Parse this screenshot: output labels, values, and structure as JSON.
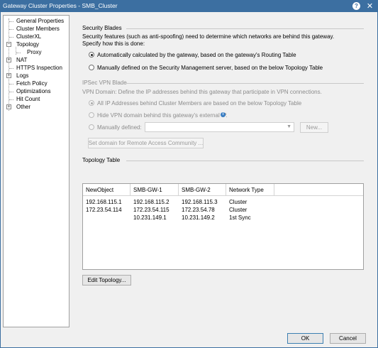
{
  "window": {
    "title": "Gateway Cluster Properties - SMB_Cluster",
    "help_icon": "?",
    "close_icon": "✕"
  },
  "tree": {
    "items": [
      {
        "label": "General Properties"
      },
      {
        "label": "Cluster Members"
      },
      {
        "label": "ClusterXL"
      },
      {
        "label": "Topology",
        "expanded": true,
        "selected": true
      },
      {
        "label": "Proxy"
      },
      {
        "label": "NAT",
        "expandable": true
      },
      {
        "label": "HTTPS Inspection"
      },
      {
        "label": "Logs",
        "expandable": true
      },
      {
        "label": "Fetch Policy"
      },
      {
        "label": "Optimizations"
      },
      {
        "label": "Hit Count"
      },
      {
        "label": "Other",
        "expandable": true
      }
    ]
  },
  "security_blades": {
    "title": "Security Blades",
    "description_1": "Security features (such as anti-spoofing) need to determine which networks are behind this gateway.",
    "description_2": "Specify how this is done:",
    "option_auto": "Automatically calculated by the gateway, based on the gateway's Routing Table",
    "option_manual": "Manually defined on the Security Management server, based on the below Topology Table",
    "selected": "auto"
  },
  "ipsec": {
    "title": "IPSec VPN Blade",
    "description": "VPN Domain: Define the IP addresses behind this gateway that participate in VPN connections.",
    "option_all": "All IP Addresses behind Cluster Members are based on the below Topology Table",
    "option_hide": "Hide VPN domain behind this gateway's external IP.",
    "option_manual": "Manually defined:",
    "new_button": "New...",
    "set_domain_button": "Set domain for Remote Access Community ...",
    "selected": "all",
    "disabled": true
  },
  "topology_table": {
    "title": "Topology Table",
    "columns": [
      "NewObject",
      "SMB-GW-1",
      "SMB-GW-2",
      "Network Type"
    ],
    "rows": [
      [
        "192.168.115.1",
        "192.168.115.2",
        "192.168.115.3",
        "Cluster"
      ],
      [
        "172.23.54.114",
        "172.23.54.115",
        "172.23.54.78",
        "Cluster"
      ],
      [
        "",
        "10.231.149.1",
        "10.231.149.2",
        "1st Sync"
      ]
    ]
  },
  "buttons": {
    "edit_topology": "Edit Topology...",
    "ok": "OK",
    "cancel": "Cancel"
  },
  "colors": {
    "titlebar": "#3c6fa1",
    "info_icon": "#3b7fc4"
  }
}
